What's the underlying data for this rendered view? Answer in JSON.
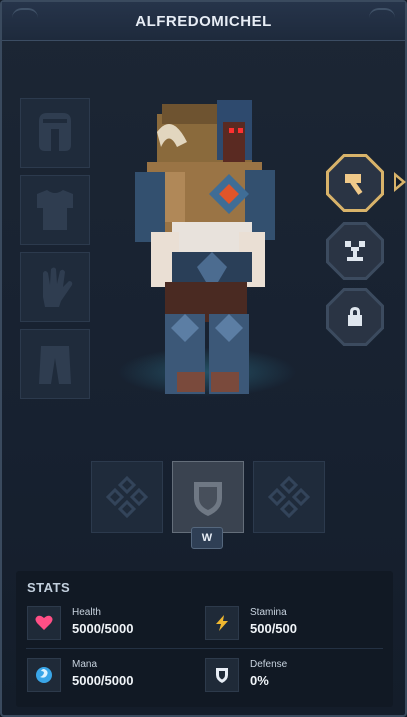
{
  "header": {
    "title": "ALFREDOMICHEL"
  },
  "armor_slots": [
    {
      "name": "helmet",
      "icon": "helmet-icon"
    },
    {
      "name": "chest",
      "icon": "chestplate-icon"
    },
    {
      "name": "gloves",
      "icon": "glove-icon"
    },
    {
      "name": "leggings",
      "icon": "leggings-icon"
    }
  ],
  "side_buttons": [
    {
      "name": "tools",
      "icon": "hammer-icon",
      "selected": true
    },
    {
      "name": "memory",
      "icon": "memory-icon",
      "selected": false
    },
    {
      "name": "locked",
      "icon": "lock-icon",
      "selected": false
    }
  ],
  "tool_slots": [
    {
      "icon": "empty-slot-icon",
      "active": false
    },
    {
      "icon": "shield-icon",
      "active": true
    },
    {
      "icon": "empty-slot-icon",
      "active": false
    }
  ],
  "keybind": "W",
  "stats": {
    "heading": "STATS",
    "items": [
      {
        "label": "Health",
        "value": "5000/5000",
        "icon": "heart-icon",
        "color": "#ff4f86"
      },
      {
        "label": "Stamina",
        "value": "500/500",
        "icon": "lightning-icon",
        "color": "#f0b830"
      },
      {
        "label": "Mana",
        "value": "5000/5000",
        "icon": "mana-swirl-icon",
        "color": "#3aa6e8"
      },
      {
        "label": "Defense",
        "value": "0%",
        "icon": "shield-icon",
        "color": "#e8eef6"
      }
    ]
  },
  "colors": {
    "accent": "#d8b36a",
    "panel": "#172130",
    "slot": "#1f2b3b"
  }
}
